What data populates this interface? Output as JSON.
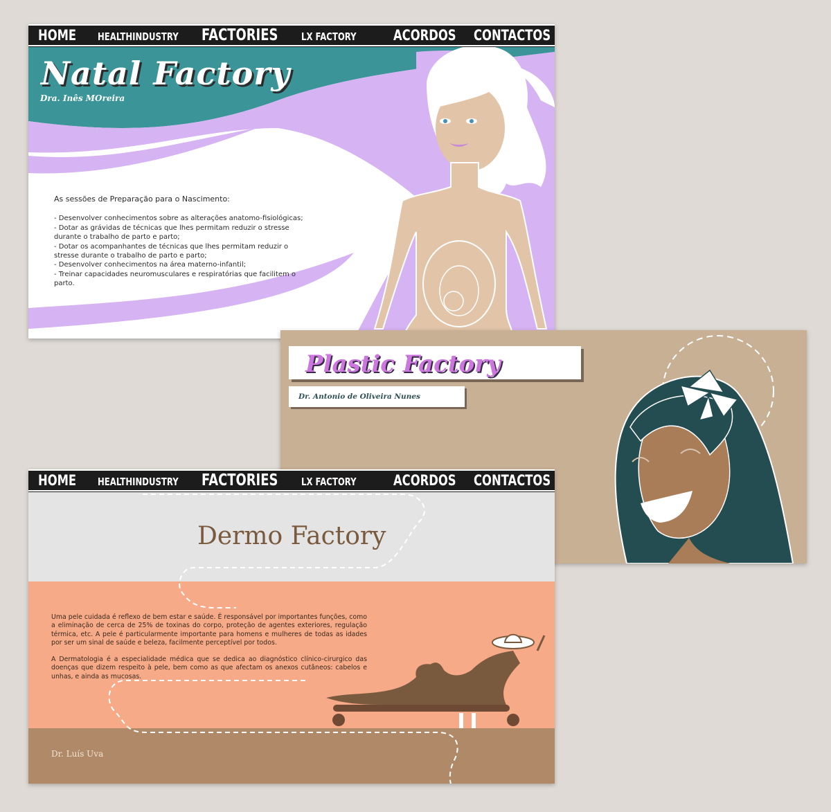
{
  "nav": {
    "home": "HOME",
    "healthindustry": "HEALTHINDUSTRY",
    "factories": "FACTORIES",
    "lxfactory": "LX FACTORY",
    "acordos": "ACORDOS",
    "contactos": "CONTACTOS"
  },
  "natal": {
    "title": "Natal Factory",
    "subtitle": "Dra. Inês MOreira",
    "intro": "As sessões de Preparação para o Nascimento:",
    "items": [
      " - Desenvolver conhecimentos sobre as alterações anatomo-fisiológicas;",
      " - Dotar as grávidas de técnicas que lhes permitam reduzir o stresse durante o trabalho de parto e parto;",
      " - Dotar os acompanhantes de técnicas que lhes permitam reduzir o stresse durante o trabalho de parto e parto;",
      " - Desenvolver conhecimentos na área materno-infantil;",
      " - Treinar capacidades neuromusculares e respiratórias que facilitem o parto."
    ]
  },
  "plastic": {
    "title": "Plastic Factory",
    "subtitle": "Dr. Antonio de Oliveira Nunes"
  },
  "dermo": {
    "title": "Dermo Factory",
    "paragraph1": " Uma pele cuidada é reflexo de bem estar e saúde. É responsável por importantes funções, como a eliminação de cerca de 25% de toxinas do corpo, proteção de agentes exteriores, regulação térmica, etc. A pele é particularmente importante para homens e mulheres de todas as idades por ser um sinal de saúde e beleza, facilmente perceptível por todos.",
    "paragraph2": " A Dermatologia é a especialidade médica que se dedica ao diagnóstico clínico-cirurgico das doenças que dizem respeito à pele, bem como as que afectam os anexos cutâneos: cabelos e unhas, e ainda as mucosas.",
    "doctor": "Dr. Luís Uva"
  },
  "colors": {
    "background": "#dfdad5",
    "nav": "#1c1c1c",
    "natal_teal": "#3b9497",
    "natal_lilac": "#d6b3f2",
    "plastic_bg": "#c8b095",
    "plastic_title": "#cc77dd",
    "hair": "#244d52",
    "dermo_salmon": "#f7aa88",
    "dermo_sand": "#b08a68",
    "dermo_gray": "#e4e4e4",
    "dermo_title": "#7a5a3e"
  }
}
